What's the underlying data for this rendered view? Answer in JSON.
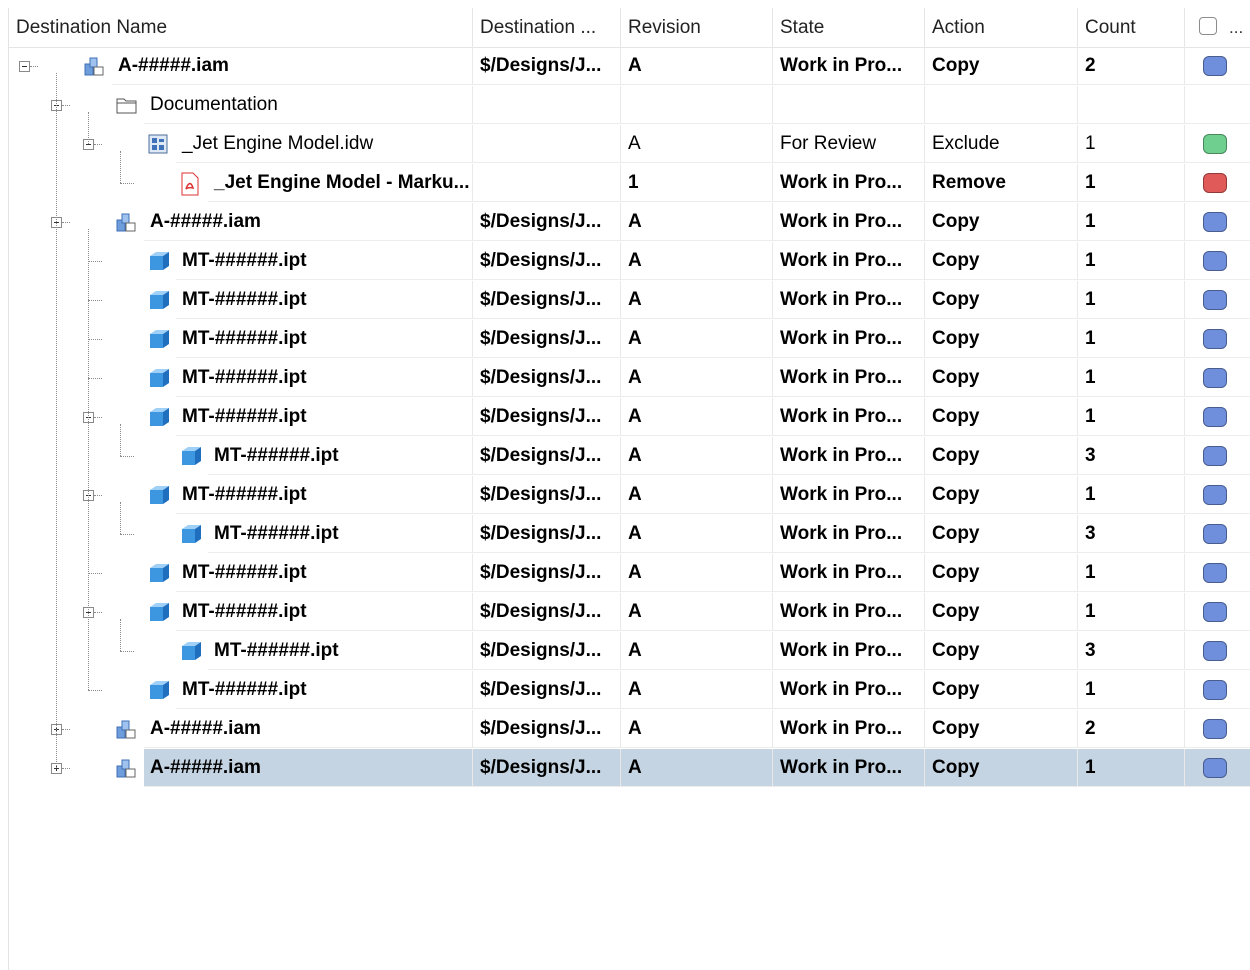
{
  "columns": [
    "Destination Name",
    "Destination ...",
    "Revision",
    "State",
    "Action",
    "Count"
  ],
  "header_more": "...",
  "colors": {
    "copy": "#6f8fdc",
    "exclude": "#6fcf8e",
    "remove": "#e05a5a",
    "selected_row": "#c5d4e2"
  },
  "rows": [
    {
      "level": 0,
      "toggle": "minus",
      "icon": "assembly-icon",
      "name": "A-#####.iam",
      "bold": true,
      "destination": "$/Designs/J...",
      "revision": "A",
      "state": "Work in Pro...",
      "action": "Copy",
      "count": "2",
      "status": "copy"
    },
    {
      "level": 1,
      "toggle": "minus",
      "icon": "folder-icon",
      "name": "Documentation",
      "bold": false,
      "destination": "",
      "revision": "",
      "state": "",
      "action": "",
      "count": "",
      "status": ""
    },
    {
      "level": 2,
      "toggle": "minus",
      "icon": "drawing-icon",
      "name": "_Jet Engine Model.idw",
      "bold": false,
      "destination": "",
      "revision": "A",
      "state": "For Review",
      "action": "Exclude",
      "count": "1",
      "status": "exclude"
    },
    {
      "level": 3,
      "toggle": "",
      "icon": "pdf-icon",
      "name": "_Jet Engine Model - Marku...",
      "bold": true,
      "destination": "",
      "revision": "1",
      "state": "Work in Pro...",
      "action": "Remove",
      "count": "1",
      "status": "remove"
    },
    {
      "level": 1,
      "toggle": "minus",
      "icon": "assembly-icon",
      "name": "A-#####.iam",
      "bold": true,
      "destination": "$/Designs/J...",
      "revision": "A",
      "state": "Work in Pro...",
      "action": "Copy",
      "count": "1",
      "status": "copy"
    },
    {
      "level": 2,
      "toggle": "",
      "icon": "part-icon",
      "name": "MT-######.ipt",
      "bold": true,
      "destination": "$/Designs/J...",
      "revision": "A",
      "state": "Work in Pro...",
      "action": "Copy",
      "count": "1",
      "status": "copy"
    },
    {
      "level": 2,
      "toggle": "",
      "icon": "part-icon",
      "name": "MT-######.ipt",
      "bold": true,
      "destination": "$/Designs/J...",
      "revision": "A",
      "state": "Work in Pro...",
      "action": "Copy",
      "count": "1",
      "status": "copy"
    },
    {
      "level": 2,
      "toggle": "",
      "icon": "part-icon",
      "name": "MT-######.ipt",
      "bold": true,
      "destination": "$/Designs/J...",
      "revision": "A",
      "state": "Work in Pro...",
      "action": "Copy",
      "count": "1",
      "status": "copy"
    },
    {
      "level": 2,
      "toggle": "",
      "icon": "part-icon",
      "name": "MT-######.ipt",
      "bold": true,
      "destination": "$/Designs/J...",
      "revision": "A",
      "state": "Work in Pro...",
      "action": "Copy",
      "count": "1",
      "status": "copy"
    },
    {
      "level": 2,
      "toggle": "minus",
      "icon": "part-icon",
      "name": "MT-######.ipt",
      "bold": true,
      "destination": "$/Designs/J...",
      "revision": "A",
      "state": "Work in Pro...",
      "action": "Copy",
      "count": "1",
      "status": "copy"
    },
    {
      "level": 3,
      "toggle": "",
      "icon": "part-icon",
      "name": "MT-######.ipt",
      "bold": true,
      "destination": "$/Designs/J...",
      "revision": "A",
      "state": "Work in Pro...",
      "action": "Copy",
      "count": "3",
      "status": "copy"
    },
    {
      "level": 2,
      "toggle": "minus",
      "icon": "part-icon",
      "name": "MT-######.ipt",
      "bold": true,
      "destination": "$/Designs/J...",
      "revision": "A",
      "state": "Work in Pro...",
      "action": "Copy",
      "count": "1",
      "status": "copy"
    },
    {
      "level": 3,
      "toggle": "",
      "icon": "part-icon",
      "name": "MT-######.ipt",
      "bold": true,
      "destination": "$/Designs/J...",
      "revision": "A",
      "state": "Work in Pro...",
      "action": "Copy",
      "count": "3",
      "status": "copy"
    },
    {
      "level": 2,
      "toggle": "",
      "icon": "part-icon",
      "name": "MT-######.ipt",
      "bold": true,
      "destination": "$/Designs/J...",
      "revision": "A",
      "state": "Work in Pro...",
      "action": "Copy",
      "count": "1",
      "status": "copy"
    },
    {
      "level": 2,
      "toggle": "minus",
      "icon": "part-icon",
      "name": "MT-######.ipt",
      "bold": true,
      "destination": "$/Designs/J...",
      "revision": "A",
      "state": "Work in Pro...",
      "action": "Copy",
      "count": "1",
      "status": "copy"
    },
    {
      "level": 3,
      "toggle": "",
      "icon": "part-icon",
      "name": "MT-######.ipt",
      "bold": true,
      "destination": "$/Designs/J...",
      "revision": "A",
      "state": "Work in Pro...",
      "action": "Copy",
      "count": "3",
      "status": "copy"
    },
    {
      "level": 2,
      "toggle": "",
      "icon": "part-icon",
      "name": "MT-######.ipt",
      "bold": true,
      "destination": "$/Designs/J...",
      "revision": "A",
      "state": "Work in Pro...",
      "action": "Copy",
      "count": "1",
      "status": "copy"
    },
    {
      "level": 1,
      "toggle": "plus",
      "icon": "assembly-icon",
      "name": "A-#####.iam",
      "bold": true,
      "destination": "$/Designs/J...",
      "revision": "A",
      "state": "Work in Pro...",
      "action": "Copy",
      "count": "2",
      "status": "copy"
    },
    {
      "level": 1,
      "toggle": "plus",
      "icon": "assembly-icon",
      "name": "A-#####.iam",
      "bold": true,
      "destination": "$/Designs/J...",
      "revision": "A",
      "state": "Work in Pro...",
      "action": "Copy",
      "count": "1",
      "status": "copy",
      "selected": true
    }
  ]
}
